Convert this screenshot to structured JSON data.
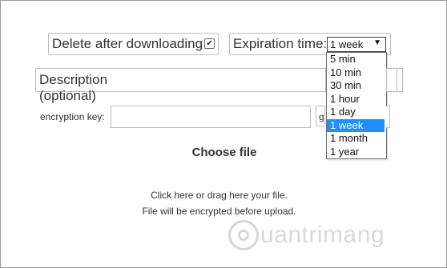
{
  "options": {
    "delete_label": "Delete after downloading",
    "delete_checked_glyph": "✔",
    "expiration_label": "Expiration time:",
    "expiration_selected": "1 week",
    "expiration_arrow": "▼",
    "expiration_options": [
      "5 min",
      "10 min",
      "30 min",
      "1 hour",
      "1 day",
      "1 week",
      "1 month",
      "1 year"
    ],
    "expiration_highlight_index": 5
  },
  "description": {
    "label": "Description (optional)",
    "value": ""
  },
  "encryption": {
    "label": "encryption key:",
    "value": "",
    "generate_button_label": "g"
  },
  "upload": {
    "choose_label": "Choose file",
    "hint_line1": "Click here or drag here your file.",
    "hint_line2": "File will be encrypted before upload."
  },
  "watermark": {
    "text": "uantrimang"
  },
  "colors": {
    "selected_option_bg": "#1e90ff",
    "border": "#bdbdbd"
  }
}
